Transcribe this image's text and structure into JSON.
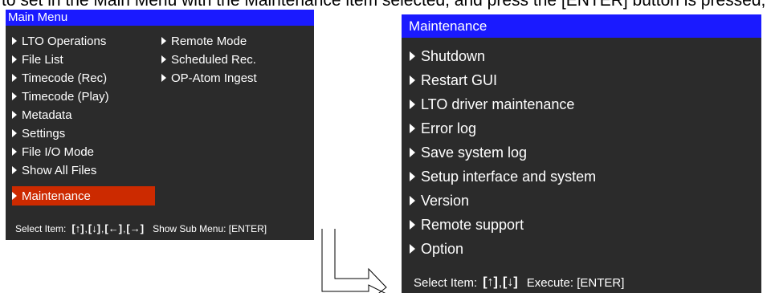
{
  "top_text": "to set in the Main Menu with the Maintenance item selected, and press the [ENTER] button is pressed, operation returns to the Main Menu.",
  "main_menu": {
    "title": "Main Menu",
    "left_items": [
      "LTO Operations",
      "File List",
      "Timecode (Rec)",
      "Timecode (Play)",
      "Metadata",
      "Settings",
      "File I/O Mode",
      "Show All Files",
      "Maintenance"
    ],
    "right_items": [
      "Remote Mode",
      "Scheduled Rec.",
      "OP-Atom Ingest"
    ],
    "selected": "Maintenance",
    "footer": {
      "select_label": "Select Item:",
      "keys": [
        "[↑]",
        "[↓]",
        "[←]",
        "[→]"
      ],
      "sub_label": "Show Sub Menu: [ENTER]"
    }
  },
  "maintenance": {
    "title": "Maintenance",
    "items": [
      "Shutdown",
      "Restart GUI",
      "LTO driver maintenance",
      "Error log",
      "Save system log",
      "Setup interface and system",
      "Version",
      "Remote support",
      "Option"
    ],
    "footer": {
      "select_label": "Select Item:",
      "keys": [
        "[↑]",
        "[↓]"
      ],
      "execute_label": "Execute: [ENTER]"
    }
  },
  "colors": {
    "title_bar": "#1a1aff",
    "panel_bg": "#2b2b2b",
    "selected_bg": "#cc2a00",
    "text": "#ffffff"
  }
}
